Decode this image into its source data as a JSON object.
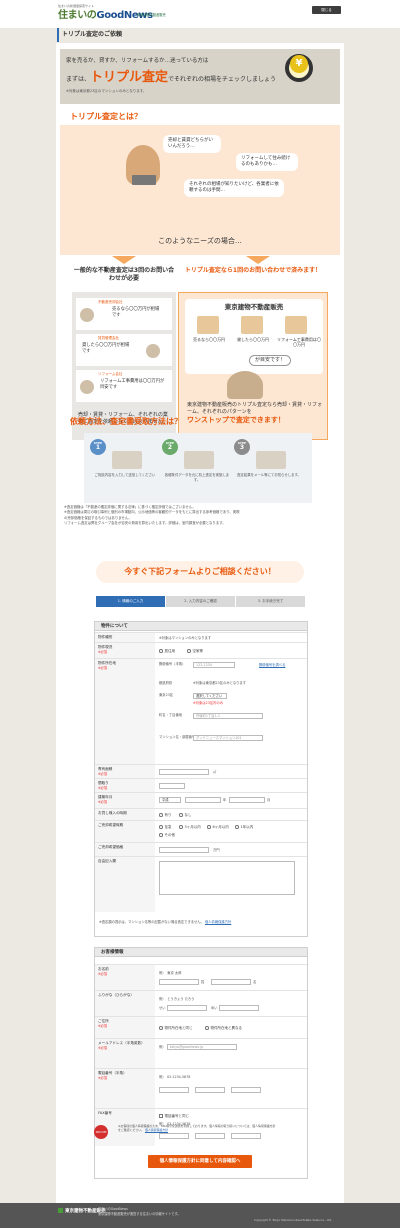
{
  "header": {
    "tagline": "住まいの新価値探索サイト",
    "logo_a": "住まいの",
    "logo_b": "GoodNews",
    "company": "東京建物不動産販売",
    "close_label": "閉じる"
  },
  "page_title": "トリプル査定のご依頼",
  "hero": {
    "line1": "家を売るか、貸すか、リフォームするか…迷っている方は",
    "line2_pre": "まずは、",
    "line2_em": "トリプル査定",
    "line2_post": "でそれぞれの相場をチェックしましょう",
    "line3": "※対象は東京都23区のマンションのみとなります。",
    "yen": "¥"
  },
  "about": {
    "heading": "トリプル査定とは？",
    "b1": "売却と賃貸どちらがいいんだろう…",
    "b2": "リフォームして住み続けるのもありかも…",
    "b3": "それぞれの相場が知りたいけど、各業者に依頼するのは手間…",
    "caption": "このようなニーズの場合…"
  },
  "left": {
    "title": "一般的な不動産査定は3回のお問い合わせが必要",
    "cards": [
      {
        "label": "不動産売却会社",
        "text": "売るなら〇〇万円が相場です"
      },
      {
        "label": "賃貸管理会社",
        "text": "貸したら〇〇万円が相場です"
      },
      {
        "label": "リフォーム会社",
        "text": "リフォーム工事費用は〇〇万円が目安です"
      }
    ],
    "foot": "売却・賃貸・リフォーム、それぞれの業者に査定を依頼しなくてはなりません。"
  },
  "right": {
    "title": "トリプル査定なら1回のお問い合わせで済みます！",
    "company": "東京建物不動産販売",
    "items": [
      "売るなら〇〇万円",
      "貸したら〇〇万円",
      "リフォーム工事費用は〇〇万円"
    ],
    "speech": "が目安です！",
    "foot": "東京建物不動産販売のトリプル査定なら売却・賃貸・リフォーム、それぞれのパターンを",
    "foot_em": "ワンストップで査定できます！"
  },
  "method": {
    "heading": "依頼方法、査定書受取方法は？",
    "steps": [
      {
        "label": "STEP",
        "num": "1",
        "text": "ご相談内容を入力して送信してください"
      },
      {
        "label": "STEP",
        "num": "2",
        "text": "各種条件データを元に机上査定を実施します。"
      },
      {
        "label": "STEP",
        "num": "3",
        "text": "査定結果をメール等にてお知らせします。"
      }
    ]
  },
  "notes": [
    "※査定価格は「不動産の鑑定評価に関する法律」に基づく鑑定評価ではございません。",
    "※査定価格は周辺の取引事例と個別の市場動向、公示地価等の客観的データをもとに算出する参考価格であり、実際の売却価格を保証するものではありません。",
    "リフォーム査定は弊社グループ会社が目安の費用を算出いたします。詳細は、室内調査が必要となります。"
  ],
  "cta": "今すぐ下記フォームよりご相談ください！",
  "progress": [
    "1. 情報のご入力",
    "2. 入力内容のご確認",
    "3. お手続き完了"
  ],
  "property": {
    "title": "物件について",
    "req": "※必須",
    "type_label": "物件種別",
    "type_value": "※対象はマンションのみとなります",
    "status_label": "物件現況",
    "status_opts": [
      "居住用",
      "空家等"
    ],
    "addr_label": "物件所在地",
    "zip_label": "郵便番号（半角）",
    "zip_ph": "123-1234",
    "zip_link": "郵便番号を調べる",
    "zip_note": "〒 →",
    "city_label": "都道府県",
    "city_value": "※対象は東京都23区のみとなります",
    "ward_label": "東京23区",
    "ward_value": "選択してください",
    "ward_note": "※対象は23区内のみ",
    "town_label": "町名・丁目番地",
    "town_ph": "丹後町1丁目1-1",
    "bld_label": "マンション名・部屋番号",
    "bld_ph": "グッドニュースマンション101",
    "area_label": "専有面積",
    "area_unit": "㎡",
    "layout_label": "間取り",
    "year_label": "建築年月",
    "era": "平成",
    "y": "年",
    "m": "月",
    "rent_label": "お貸し様入の時期",
    "rent_opts": [
      "有り",
      "なし"
    ],
    "timing_label": "ご売却希望時期",
    "timing_opts": [
      "至急",
      "3ヶ月以内",
      "6ヶ月以内",
      "1年以内",
      "その他"
    ],
    "price_label": "ご売却希望価格",
    "price_unit": "万円",
    "memo_label": "自由記入欄",
    "foot": "※査定額の提示は、マンション名等の記載がない場合査定できません。",
    "foot_link": "個人情報保護方針"
  },
  "customer": {
    "title": "お客様情報",
    "req": "※必須",
    "name_label": "お名前",
    "name_ph": "例）　東京 太郎",
    "name_sei": "姓",
    "name_mei": "名",
    "kana_label": "ふりがな（ひらがな）",
    "kana_ph": "例）　とうきょう たろう",
    "kana_sei": "せい",
    "kana_mei": "めい",
    "addr_label": "ご住所",
    "addr_opts": [
      "物件所在地と同じ",
      "物件所在地と異なる"
    ],
    "mail_label": "メールアドレス（半角英数）",
    "mail_ph": "tokyo@goodnews.jp",
    "tel_label": "電話番号（半角）",
    "tel_ph": "03-1234-5678",
    "fax_label": "FAX番号",
    "fax_chk": "電話番号と同じ",
    "fax_ph": "03-1234-5678"
  },
  "privacy": {
    "badge": "SECOM",
    "text": "※お客様の個人情報保護のため、SSL暗号化通信を利用しております。個人情報の取り扱いについては、個人情報保護方針をご確認ください。",
    "link": "個人情報保護方針"
  },
  "submit": "個人情報保護方針に同意して内容確認へ",
  "footer": {
    "company": "東京建物不動産販売",
    "site": "住まいのGoodNews",
    "desc": "東京建物不動産販売が運営する住まいの情報サイトです。",
    "copy": "Copyright © Tokyo Tatemono Real Estate Sales Co., Ltd."
  },
  "colors": {
    "accent": "#e8580c",
    "blue": "#2f6db5",
    "green": "#4a9b3a"
  }
}
